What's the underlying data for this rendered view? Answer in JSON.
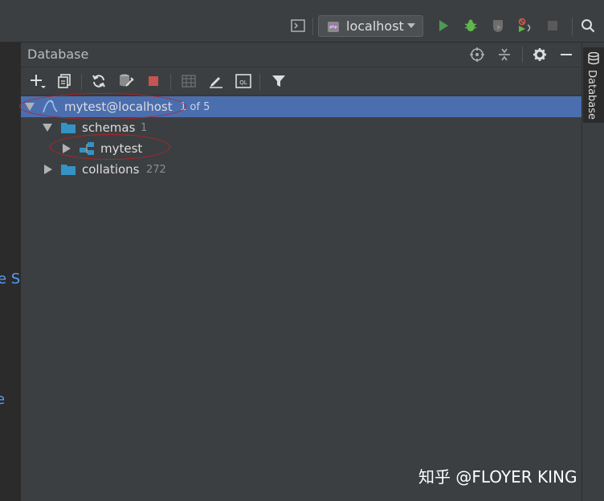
{
  "run_config": {
    "label": "localhost"
  },
  "left_edge": {
    "fragment_1": "le S",
    "fragment_2": "e"
  },
  "panel": {
    "title": "Database"
  },
  "tree": [
    {
      "label": "mytest@localhost",
      "count": "1 of 5"
    },
    {
      "label": "schemas",
      "count": "1"
    },
    {
      "label": "mytest",
      "count": ""
    },
    {
      "label": "collations",
      "count": "272"
    }
  ],
  "right_strip": {
    "tab_label": "Database"
  },
  "watermark": "知乎 @FLOYER KING",
  "colors": {
    "selection": "#4b6eaf",
    "folder": "#3592c4",
    "annotation": "#b3222b",
    "run": "#499c54",
    "debug": "#5fb84a",
    "stop": "#c75450"
  }
}
